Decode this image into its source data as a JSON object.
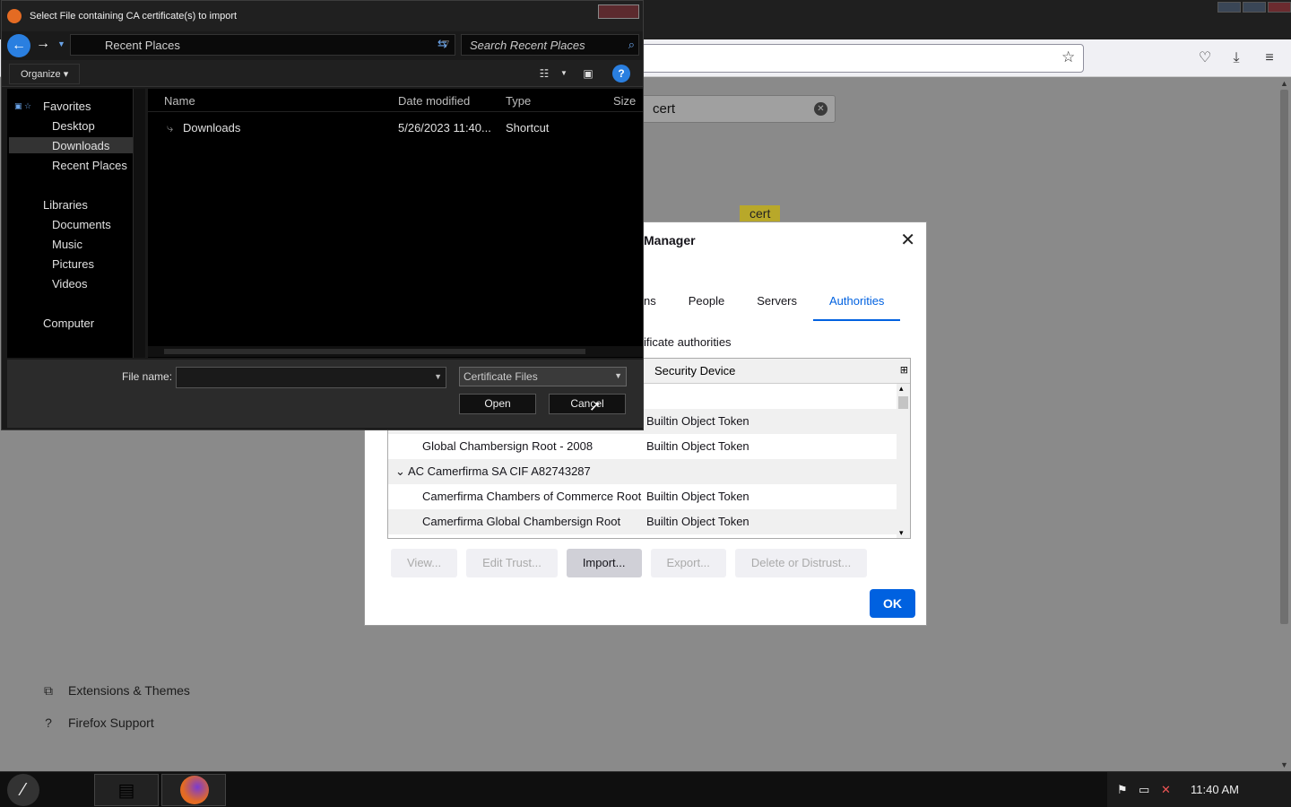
{
  "firefox": {
    "search_value": "cert",
    "highlight": "cert",
    "side_links": [
      {
        "label": "Extensions & Themes"
      },
      {
        "label": "Firefox Support"
      }
    ]
  },
  "cert_manager": {
    "title": "Manager",
    "tabs": [
      {
        "label": "ns"
      },
      {
        "label": "People"
      },
      {
        "label": "Servers"
      },
      {
        "label": "Authorities"
      }
    ],
    "selected_tab": "Authorities",
    "description": "ificate authorities",
    "column_header": "Security Device",
    "rows": [
      {
        "name": "",
        "device": "Builtin Object Token"
      },
      {
        "name": "Global Chambersign Root - 2008",
        "device": "Builtin Object Token"
      },
      {
        "name": "AC Camerfirma SA CIF A82743287",
        "device": "",
        "group": true
      },
      {
        "name": "Camerfirma Chambers of Commerce Root",
        "device": "Builtin Object Token"
      },
      {
        "name": "Camerfirma Global Chambersign Root",
        "device": "Builtin Object Token"
      }
    ],
    "buttons": {
      "view": "View...",
      "edit_trust": "Edit Trust...",
      "import": "Import...",
      "export": "Export...",
      "delete": "Delete or Distrust..."
    },
    "ok": "OK"
  },
  "file_dialog": {
    "title": "Select File containing CA certificate(s) to import",
    "address": "Recent Places",
    "search_placeholder": "Search Recent Places",
    "organize": "Organize ▾",
    "nav": {
      "favorites": "Favorites",
      "desktop": "Desktop",
      "downloads": "Downloads",
      "recent": "Recent Places",
      "libraries": "Libraries",
      "documents": "Documents",
      "music": "Music",
      "pictures": "Pictures",
      "videos": "Videos",
      "computer": "Computer"
    },
    "columns": {
      "name": "Name",
      "date": "Date modified",
      "type": "Type",
      "size": "Size"
    },
    "files": [
      {
        "name": "Downloads",
        "date": "5/26/2023 11:40...",
        "type": "Shortcut"
      }
    ],
    "file_name_label": "File name:",
    "file_name_value": "",
    "file_type": "Certificate Files",
    "open": "Open",
    "cancel": "Cancel"
  },
  "taskbar": {
    "clock": "11:40 AM"
  }
}
